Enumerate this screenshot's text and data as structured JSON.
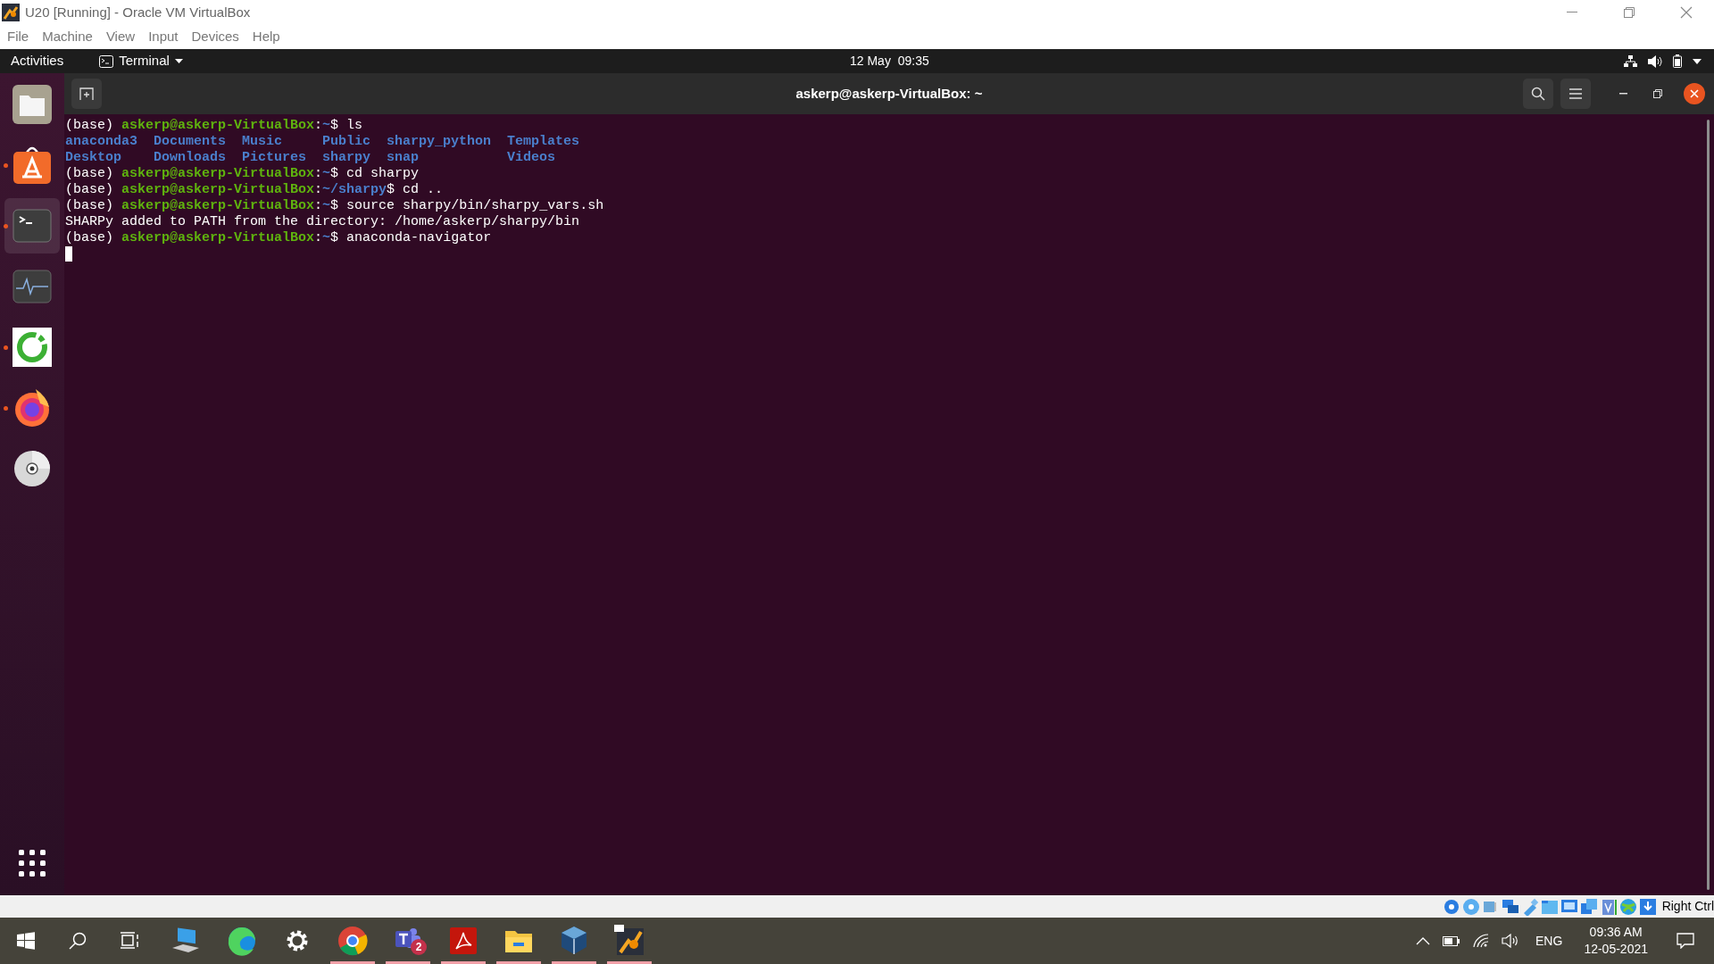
{
  "window": {
    "title": "U20 [Running] - Oracle VM VirtualBox"
  },
  "menu": [
    "File",
    "Machine",
    "View",
    "Input",
    "Devices",
    "Help"
  ],
  "top_bar": {
    "activities": "Activities",
    "app_menu": "Terminal",
    "clock": "12 May  09:35"
  },
  "dock": {
    "items": [
      {
        "kind": "files",
        "running": false,
        "selected": false
      },
      {
        "kind": "software",
        "running": true,
        "selected": false
      },
      {
        "kind": "terminal",
        "running": true,
        "selected": true
      },
      {
        "kind": "monitor",
        "running": false,
        "selected": false
      },
      {
        "kind": "ring",
        "running": true,
        "selected": false
      },
      {
        "kind": "firefox",
        "running": true,
        "selected": false
      },
      {
        "kind": "disc",
        "running": false,
        "selected": false
      }
    ]
  },
  "terminal": {
    "title": "askerp@askerp-VirtualBox: ~",
    "lines": [
      {
        "kind": "prompt",
        "env": "(base)",
        "user": "askerp@askerp-VirtualBox",
        "colon": ":",
        "path": "~",
        "dollar": "$",
        "command": "ls"
      },
      {
        "kind": "listing",
        "entries": [
          "anaconda3",
          "Documents",
          "Music",
          "Public",
          "sharpy_python",
          "Templates"
        ]
      },
      {
        "kind": "listing",
        "entries": [
          "Desktop",
          "Downloads",
          "Pictures",
          "sharpy",
          "snap",
          "Videos"
        ]
      },
      {
        "kind": "prompt",
        "env": "(base)",
        "user": "askerp@askerp-VirtualBox",
        "colon": ":",
        "path": "~",
        "dollar": "$",
        "command": "cd sharpy"
      },
      {
        "kind": "prompt",
        "env": "(base)",
        "user": "askerp@askerp-VirtualBox",
        "colon": ":",
        "path": "~/sharpy",
        "dollar": "$",
        "command": "cd .."
      },
      {
        "kind": "prompt",
        "env": "(base)",
        "user": "askerp@askerp-VirtualBox",
        "colon": ":",
        "path": "~",
        "dollar": "$",
        "command": "source sharpy/bin/sharpy_vars.sh"
      },
      {
        "kind": "output",
        "text": "SHARPy added to PATH from the directory: /home/askerp/sharpy/bin"
      },
      {
        "kind": "prompt",
        "env": "(base)",
        "user": "askerp@askerp-VirtualBox",
        "colon": ":",
        "path": "~",
        "dollar": "$",
        "command": "anaconda-navigator"
      },
      {
        "kind": "cursor"
      }
    ]
  },
  "status_bar": {
    "host_key": "Right Ctrl"
  },
  "taskbar": {
    "apps": [
      {
        "kind": "computer",
        "running": false
      },
      {
        "kind": "edge",
        "running": false
      },
      {
        "kind": "settings",
        "running": false
      },
      {
        "kind": "chrome",
        "running": true
      },
      {
        "kind": "teams",
        "running": true,
        "badge": "2"
      },
      {
        "kind": "acrobat",
        "running": true
      },
      {
        "kind": "explorer",
        "running": true
      },
      {
        "kind": "virtualbox",
        "running": true
      },
      {
        "kind": "vm",
        "running": true
      }
    ],
    "language": "ENG",
    "time": "09:36 AM",
    "date": "12-05-2021"
  }
}
